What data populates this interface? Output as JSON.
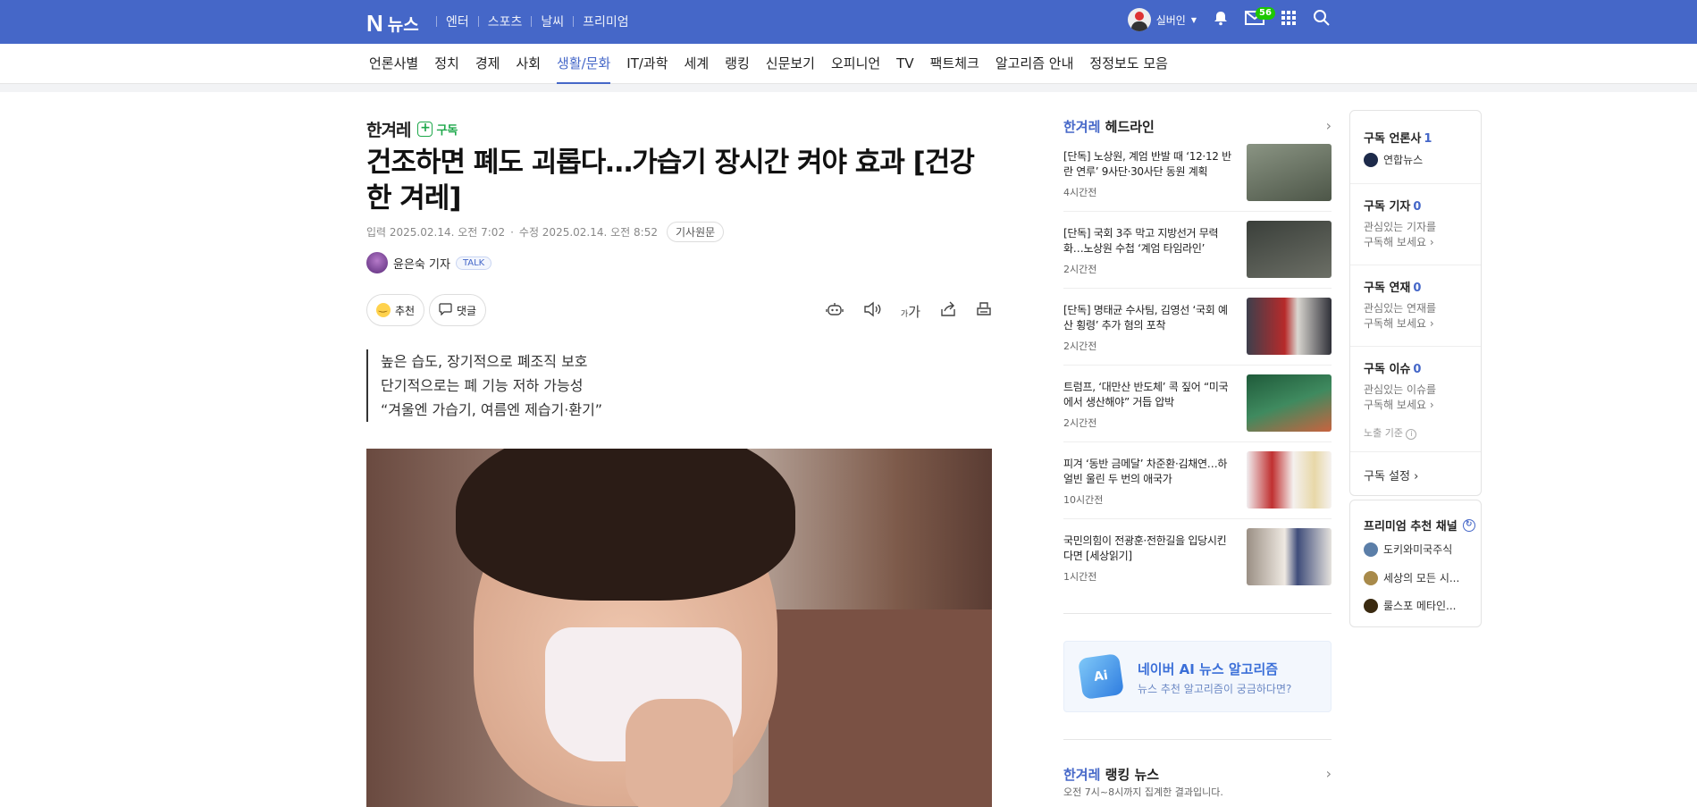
{
  "topbar": {
    "logo_n": "N",
    "logo_text": "뉴스",
    "links": [
      "엔터",
      "스포츠",
      "날씨",
      "프리미엄"
    ],
    "user_name": "실버인",
    "mail_count": "56"
  },
  "nav": {
    "items": [
      "언론사별",
      "정치",
      "경제",
      "사회",
      "생활/문화",
      "IT/과학",
      "세계",
      "랭킹",
      "신문보기",
      "오피니언",
      "TV",
      "팩트체크",
      "알고리즘 안내",
      "정정보도 모음"
    ],
    "active": "생활/문화"
  },
  "article": {
    "press": "한겨레",
    "subscribe": "구독",
    "headline": "건조하면 폐도 괴롭다…가습기 장시간 켜야 효과 [건강한 겨레]",
    "input_time": "입력 2025.02.14. 오전 7:02",
    "edit_time": "수정 2025.02.14. 오전 8:52",
    "original_link": "기사원문",
    "reporter": "윤은숙 기자",
    "talk": "TALK",
    "recommend": "추천",
    "comments": "댓글",
    "font_tool": "가",
    "summary": [
      "높은 습도, 장기적으로 폐조직 보호",
      "단기적으로는 폐 기능 저하 가능성",
      "“겨울엔 가습기, 여름엔 제습기·환기”"
    ]
  },
  "headlines": {
    "press": "한겨레",
    "title": "헤드라인",
    "items": [
      {
        "title": "[단독] 노상원, 계엄 반발 때 ‘12·12 반란 연루’ 9사단·30사단 동원 계획",
        "time": "4시간전",
        "color": "#6f7b6a"
      },
      {
        "title": "[단독] 국회 3주 막고 지방선거 무력화…노상원 수첩 ‘계엄 타임라인’",
        "time": "2시간전",
        "color": "#4a4f4a"
      },
      {
        "title": "[단독] 명태균 수사팀, 김영선 ‘국회 예산 횡령’ 추가 혐의 포착",
        "time": "2시간전",
        "color": "#5a5a66"
      },
      {
        "title": "트럼프, ‘대만산 반도체’ 콕 짚어 “미국에서 생산해야” 거듭 압박",
        "time": "2시간전",
        "color": "#2f6a4a"
      },
      {
        "title": "피겨 ‘동반 금메달’ 차준환·김채연…하얼빈 울린 두 번의 애국가",
        "time": "10시간전",
        "color": "#d9d2dc"
      },
      {
        "title": "국민의힘이 전광훈·전한길을 입당시킨다면 [세상읽기]",
        "time": "1시간전",
        "color": "#b9b6b0"
      }
    ]
  },
  "ai_box": {
    "title": "네이버 AI 뉴스 알고리즘",
    "subtitle": "뉴스 추천 알고리즘이 궁금하다면?",
    "icon_text": "Ai"
  },
  "ranking": {
    "press": "한겨레",
    "title": "랭킹 뉴스",
    "subtitle": "오전 7시~8시까지 집계한 결과입니다."
  },
  "subs_panel": {
    "press_label": "구독 언론사",
    "press_count": "1",
    "press_item": "연합뉴스",
    "reporter_label": "구독 기자",
    "reporter_count": "0",
    "reporter_desc1": "관심있는 기자를",
    "reporter_desc2": "구독해 보세요",
    "series_label": "구독 연재",
    "series_count": "0",
    "series_desc1": "관심있는 연재를",
    "series_desc2": "구독해 보세요",
    "issue_label": "구독 이슈",
    "issue_count": "0",
    "issue_desc1": "관심있는 이슈를",
    "issue_desc2": "구독해 보세요",
    "exposure": "노출 기준",
    "settings": "구독 설정"
  },
  "premium_panel": {
    "title": "프리미엄 추천 채널",
    "channels": [
      {
        "name": "도키와미국주식",
        "color": "#5b7ea8"
      },
      {
        "name": "세상의 모든 시...",
        "color": "#a88a4a"
      },
      {
        "name": "룰스포 메타인...",
        "color": "#3a2a10"
      }
    ]
  }
}
